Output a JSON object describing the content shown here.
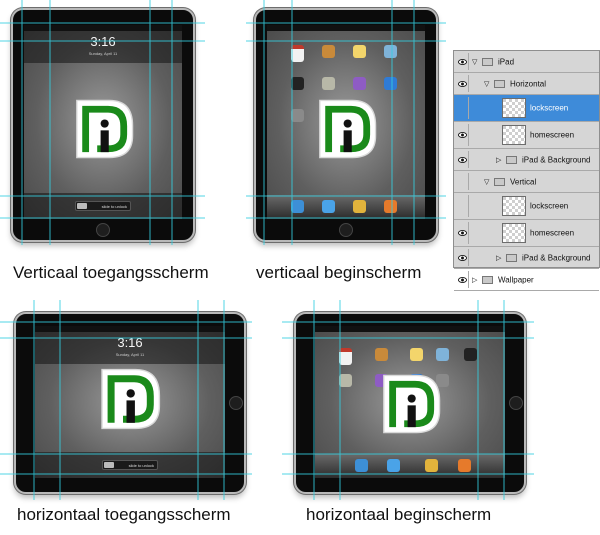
{
  "screens": {
    "lock_time": "3:16",
    "lock_date": "Sunday, April 11",
    "slide_text": "slide to unlock"
  },
  "captions": {
    "vertical_lock": "Verticaal toegangsscherm",
    "vertical_home": "verticaal beginscherm",
    "horizontal_lock": "horizontaal toegangsscherm",
    "horizontal_home": "horizontaal beginscherm"
  },
  "layers": [
    {
      "name": "iPad",
      "kind": "group",
      "level": 0,
      "visible": true,
      "expanded": true,
      "selected": false
    },
    {
      "name": "Horizontal",
      "kind": "group",
      "level": 1,
      "visible": true,
      "expanded": true,
      "selected": false
    },
    {
      "name": "lockscreen",
      "kind": "layer",
      "level": 2,
      "visible": false,
      "expanded": false,
      "selected": true
    },
    {
      "name": "homescreen",
      "kind": "layer",
      "level": 2,
      "visible": true,
      "expanded": false,
      "selected": false
    },
    {
      "name": "iPad & Background",
      "kind": "group",
      "level": 2,
      "visible": true,
      "expanded": false,
      "selected": false
    },
    {
      "name": "Vertical",
      "kind": "group",
      "level": 1,
      "visible": false,
      "expanded": true,
      "selected": false
    },
    {
      "name": "lockscreen",
      "kind": "layer",
      "level": 2,
      "visible": false,
      "expanded": false,
      "selected": false
    },
    {
      "name": "homescreen",
      "kind": "layer",
      "level": 2,
      "visible": true,
      "expanded": false,
      "selected": false
    },
    {
      "name": "iPad & Background",
      "kind": "group",
      "level": 2,
      "visible": true,
      "expanded": false,
      "selected": false
    },
    {
      "name": "Wallpaper",
      "kind": "group",
      "level": 0,
      "visible": true,
      "expanded": false,
      "selected": false
    }
  ],
  "colors": {
    "logo_green": "#1a8a1a",
    "guide_cyan": "#35cfe0",
    "selected_layer": "#3e8bd9"
  }
}
